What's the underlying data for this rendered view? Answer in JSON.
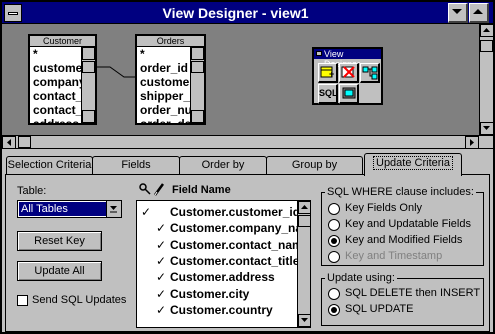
{
  "window": {
    "title": "View Designer - view1"
  },
  "canvas": {
    "customer_table": {
      "caption": "Customer",
      "fields": [
        "*",
        "customer_id",
        "company_name",
        "contact_name",
        "contact_title",
        "address"
      ]
    },
    "orders_table": {
      "caption": "Orders",
      "fields": [
        "*",
        "order_id",
        "customer_id",
        "shipper_id",
        "order_number",
        "order_date"
      ]
    },
    "palette": {
      "caption": "View Designer",
      "sql_label": "SQL",
      "icons": [
        "add-table-icon",
        "remove-table-icon",
        "join-icon",
        "sql-icon",
        "view-output-icon"
      ]
    }
  },
  "tabs": [
    {
      "label": "Selection Criteria",
      "active": false
    },
    {
      "label": "Fields",
      "active": false
    },
    {
      "label": "Order by",
      "active": false
    },
    {
      "label": "Group by",
      "active": false
    },
    {
      "label": "Update Criteria",
      "active": true
    }
  ],
  "update_criteria": {
    "table_label": "Table:",
    "table_value": "All Tables",
    "reset_key_label": "Reset Key",
    "update_all_label": "Update All",
    "send_sql_updates_label": "Send SQL Updates",
    "send_sql_updates_checked": false,
    "field_header": "Field Name",
    "field_rows": [
      {
        "name": "Customer.customer_id",
        "key": true,
        "updatable": false
      },
      {
        "name": "Customer.company_name",
        "key": false,
        "updatable": true
      },
      {
        "name": "Customer.contact_name",
        "key": false,
        "updatable": true
      },
      {
        "name": "Customer.contact_title",
        "key": false,
        "updatable": true
      },
      {
        "name": "Customer.address",
        "key": false,
        "updatable": true
      },
      {
        "name": "Customer.city",
        "key": false,
        "updatable": true
      },
      {
        "name": "Customer.country",
        "key": false,
        "updatable": true
      }
    ],
    "where_group": {
      "title": "SQL WHERE clause includes:",
      "options": [
        {
          "label": "Key Fields Only",
          "selected": false,
          "enabled": true
        },
        {
          "label": "Key and Updatable Fields",
          "selected": false,
          "enabled": true
        },
        {
          "label": "Key and Modified Fields",
          "selected": true,
          "enabled": true
        },
        {
          "label": "Key and Timestamp",
          "selected": false,
          "enabled": false
        }
      ]
    },
    "update_group": {
      "title": "Update using:",
      "options": [
        {
          "label": "SQL DELETE then INSERT",
          "selected": false
        },
        {
          "label": "SQL UPDATE",
          "selected": true
        }
      ]
    }
  },
  "colors": {
    "titlebar": "#000080",
    "face": "#c0c0c0",
    "canvas": "#808080"
  }
}
